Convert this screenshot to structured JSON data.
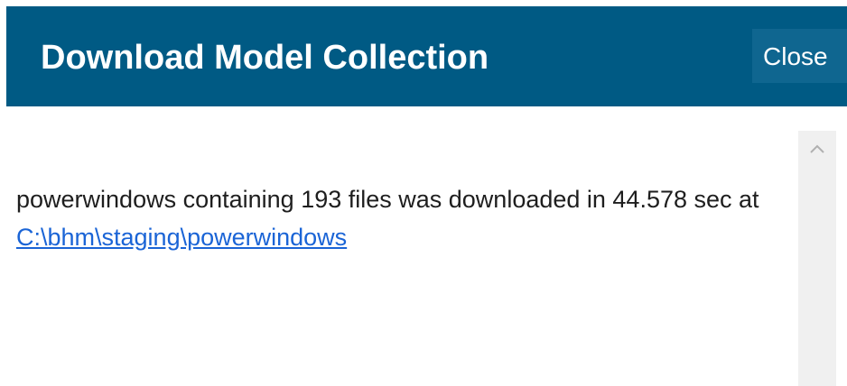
{
  "dialog": {
    "title": "Download Model Collection",
    "close_label": "Close"
  },
  "message": {
    "model_name": "powerwindows",
    "text_part1": " containing 193 files was downloaded in 44.578 sec at ",
    "path_link": "C:\\bhm\\staging\\powerwindows"
  },
  "scrollbar": {
    "up_icon": "chevron-up-icon"
  },
  "colors": {
    "header_bg": "#005a84",
    "close_bg": "#0f6690",
    "link": "#1a64d6",
    "text": "#1e1e1e"
  }
}
